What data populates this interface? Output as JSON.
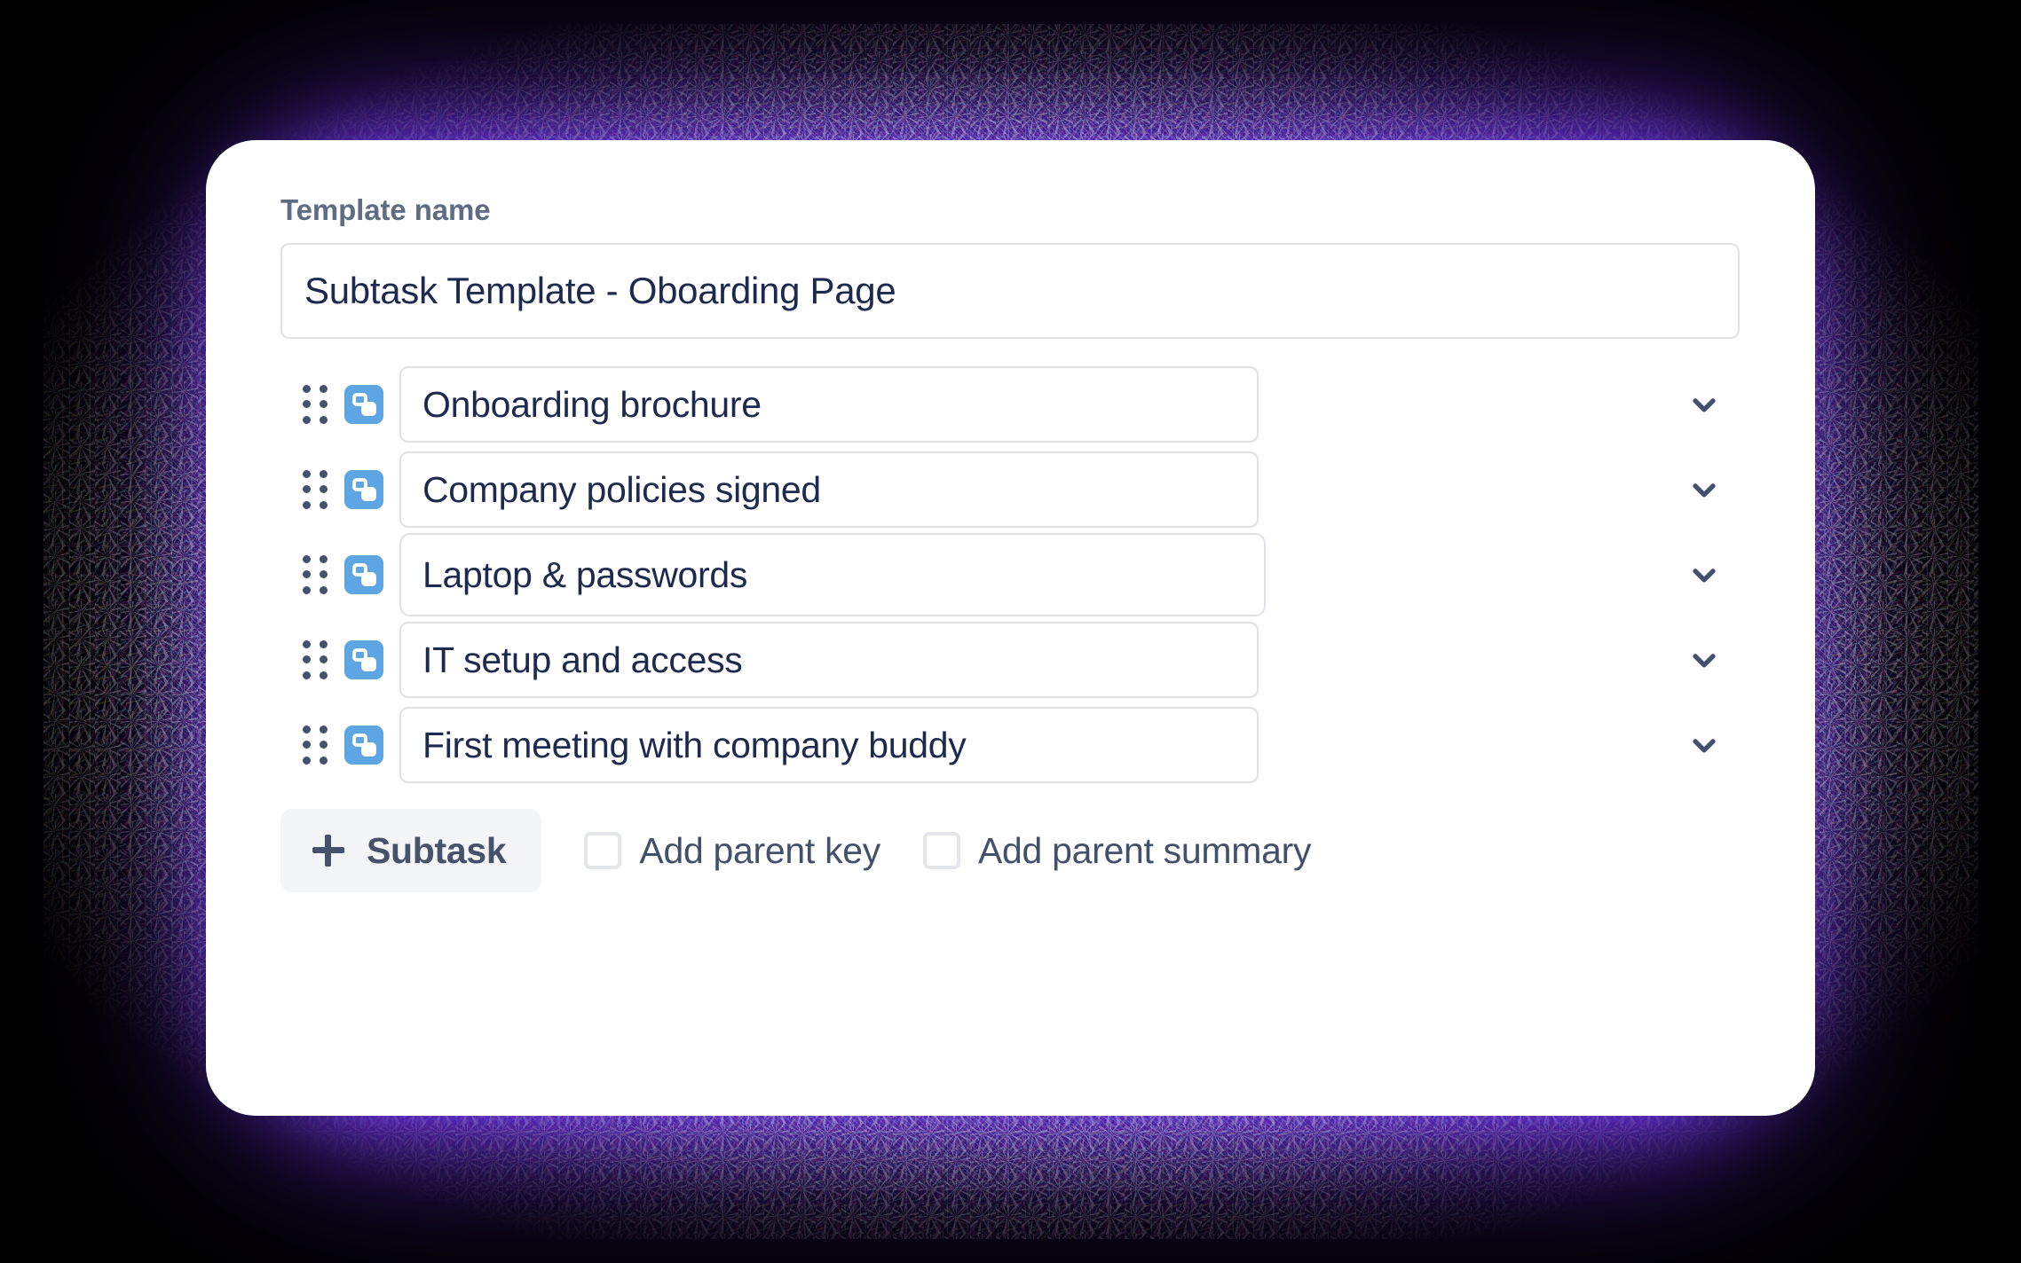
{
  "theme": {
    "glow_color": "#7034F0",
    "card_background": "#FFFFFF",
    "page_background": "#000000",
    "input_border": "#DFE1E6",
    "input_text": "#1B2A4E",
    "label_text": "#5E6C84",
    "subtask_icon_blue": "#5EA5E3",
    "chevron_color": "#44506E",
    "button_background": "#F4F5F7",
    "button_text": "#46526B"
  },
  "form": {
    "template_name_label": "Template name",
    "template_name_value": "Subtask Template - Oboarding Page",
    "template_name_placeholder": "Template name"
  },
  "subtasks": [
    {
      "value": "Onboarding brochure",
      "icon": "subtask-icon",
      "expand_icon": "chevron-down-icon",
      "drag_icon": "drag-handle-icon",
      "active": false,
      "field_width": 968
    },
    {
      "value": "Company policies signed",
      "icon": "subtask-icon",
      "expand_icon": "chevron-down-icon",
      "drag_icon": "drag-handle-icon",
      "active": false,
      "field_width": 968
    },
    {
      "value": "Laptop & passwords",
      "icon": "subtask-icon",
      "expand_icon": "chevron-down-icon",
      "drag_icon": "drag-handle-icon",
      "active": true,
      "field_width": 976
    },
    {
      "value": "IT setup and access",
      "icon": "subtask-icon",
      "expand_icon": "chevron-down-icon",
      "drag_icon": "drag-handle-icon",
      "active": false,
      "field_width": 968
    },
    {
      "value": "First meeting with company buddy",
      "icon": "subtask-icon",
      "expand_icon": "chevron-down-icon",
      "drag_icon": "drag-handle-icon",
      "active": false,
      "field_width": 968
    }
  ],
  "actions": {
    "add_subtask_label": "Subtask",
    "add_subtask_icon": "plus-icon",
    "checkboxes": [
      {
        "label": "Add parent key",
        "checked": false
      },
      {
        "label": "Add parent summary",
        "checked": false
      }
    ]
  }
}
